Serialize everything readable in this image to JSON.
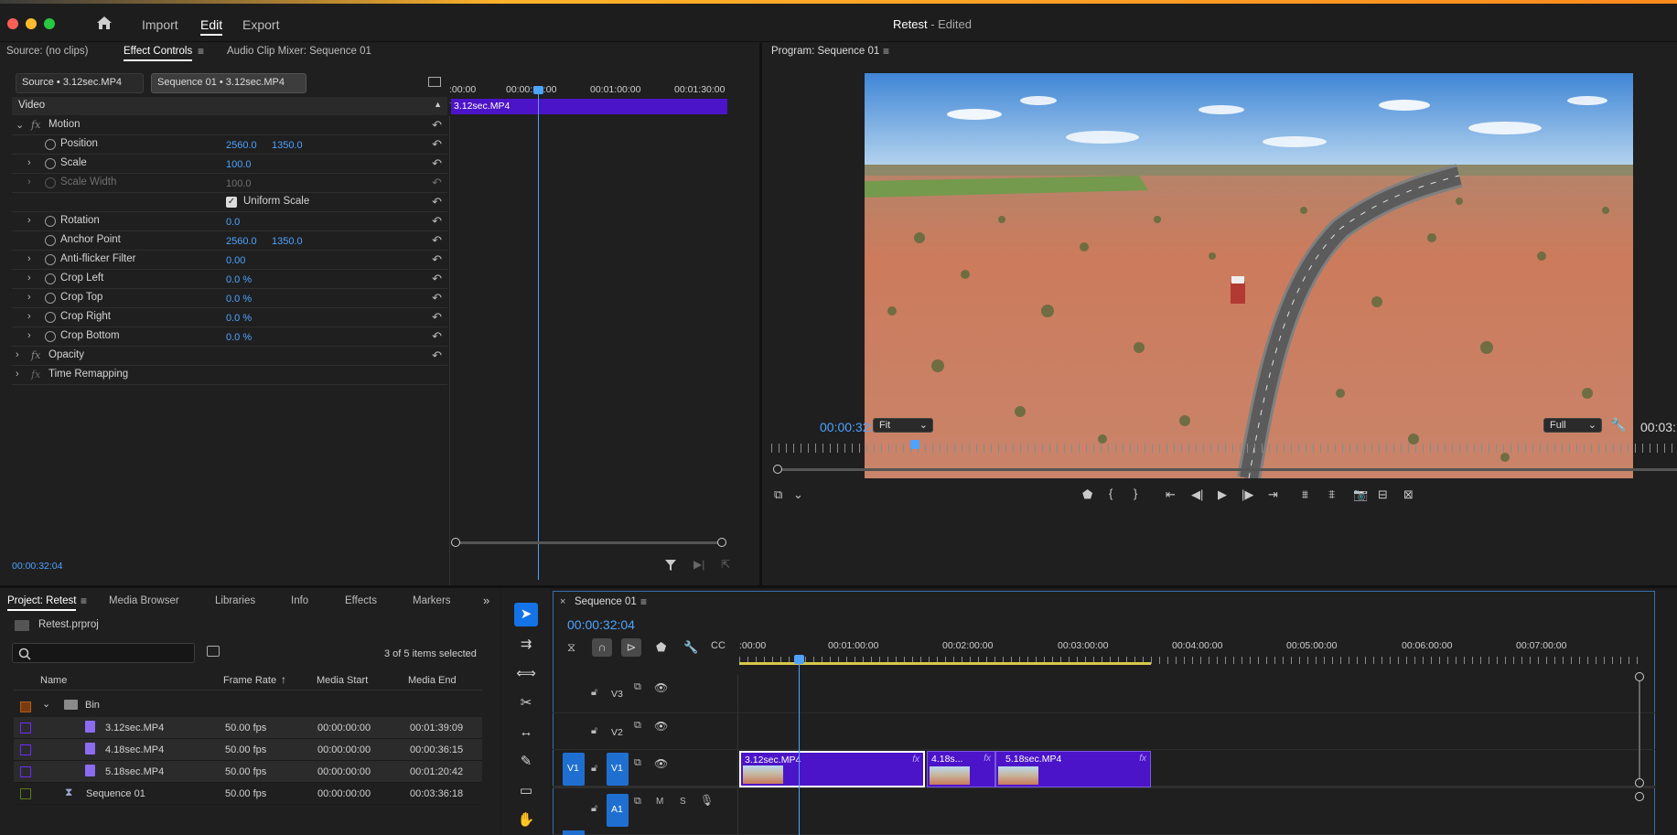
{
  "app": {
    "menu": [
      "Import",
      "Edit",
      "Export"
    ],
    "active_menu": "Edit",
    "project_title": "Retest",
    "title_suffix": " - Edited"
  },
  "source_panel": {
    "tabs": [
      "Source: (no clips)",
      "Effect Controls",
      "Audio Clip Mixer: Sequence 01"
    ],
    "active_tab": "Effect Controls",
    "subtabs": [
      "Source • 3.12sec.MP4",
      "Sequence 01 • 3.12sec.MP4"
    ],
    "section": "Video",
    "ruler_ticks": [
      ":00:00",
      "00:00:30:00",
      "00:01:00:00",
      "00:01:30:00"
    ],
    "clip_label": "3.12sec.MP4",
    "timecode": "00:00:32:04",
    "properties": [
      {
        "label": "Motion",
        "fx": true
      },
      {
        "label": "Position",
        "v1": "2560.0",
        "v2": "1350.0"
      },
      {
        "label": "Scale",
        "v1": "100.0"
      },
      {
        "label": "Scale Width",
        "v1": "100.0",
        "disabled": true
      },
      {
        "label": "Uniform Scale",
        "checkbox": true
      },
      {
        "label": "Rotation",
        "v1": "0.0"
      },
      {
        "label": "Anchor Point",
        "v1": "2560.0",
        "v2": "1350.0"
      },
      {
        "label": "Anti-flicker Filter",
        "v1": "0.00"
      },
      {
        "label": "Crop Left",
        "v1": "0.0 %"
      },
      {
        "label": "Crop Top",
        "v1": "0.0 %"
      },
      {
        "label": "Crop Right",
        "v1": "0.0 %"
      },
      {
        "label": "Crop Bottom",
        "v1": "0.0 %"
      },
      {
        "label": "Opacity",
        "fx": true
      },
      {
        "label": "Time Remapping",
        "fx": true
      }
    ]
  },
  "program": {
    "title": "Program: Sequence 01",
    "timecode": "00:00:32:04",
    "fit_label": "Fit",
    "full_label": "Full",
    "duration_partial": "00:03:"
  },
  "project": {
    "tabs": [
      "Project: Retest",
      "Media Browser",
      "Libraries",
      "Info",
      "Effects",
      "Markers"
    ],
    "file": "Retest.prproj",
    "search_placeholder": "",
    "selection": "3 of 5 items selected",
    "columns": [
      "Name",
      "Frame Rate",
      "Media Start",
      "Media End"
    ],
    "bin_label": "Bin",
    "items": [
      {
        "name": "3.12sec.MP4",
        "fps": "50.00 fps",
        "start": "00:00:00:00",
        "end": "00:01:39:09",
        "color": "#6a2cff"
      },
      {
        "name": "4.18sec.MP4",
        "fps": "50.00 fps",
        "start": "00:00:00:00",
        "end": "00:00:36:15",
        "color": "#6a2cff"
      },
      {
        "name": "5.18sec.MP4",
        "fps": "50.00 fps",
        "start": "00:00:00:00",
        "end": "00:01:20:42",
        "color": "#6a2cff"
      },
      {
        "name": "Sequence 01",
        "fps": "50.00 fps",
        "start": "00:00:00:00",
        "end": "00:03:36:18",
        "color": "#5a7a1a"
      }
    ]
  },
  "timeline": {
    "tab": "Sequence 01",
    "timecode": "00:00:32:04",
    "ruler": [
      ":00:00",
      "00:01:00:00",
      "00:02:00:00",
      "00:03:00:00",
      "00:04:00:00",
      "00:05:00:00",
      "00:06:00:00",
      "00:07:00:00"
    ],
    "tracks": [
      "V3",
      "V2",
      "V1",
      "A1"
    ],
    "source_patch_v": "V1",
    "source_patch_a": "A1",
    "audio_flags": [
      "M",
      "S"
    ],
    "clips": [
      {
        "label": "3.12sec.MP4"
      },
      {
        "label": "4.18s..."
      },
      {
        "label": "5.18sec.MP4"
      }
    ]
  },
  "colors": {
    "accent": "#4ea3ff",
    "clip": "#4c14c8",
    "panel": "#232323",
    "background": "#1d1d1d"
  }
}
